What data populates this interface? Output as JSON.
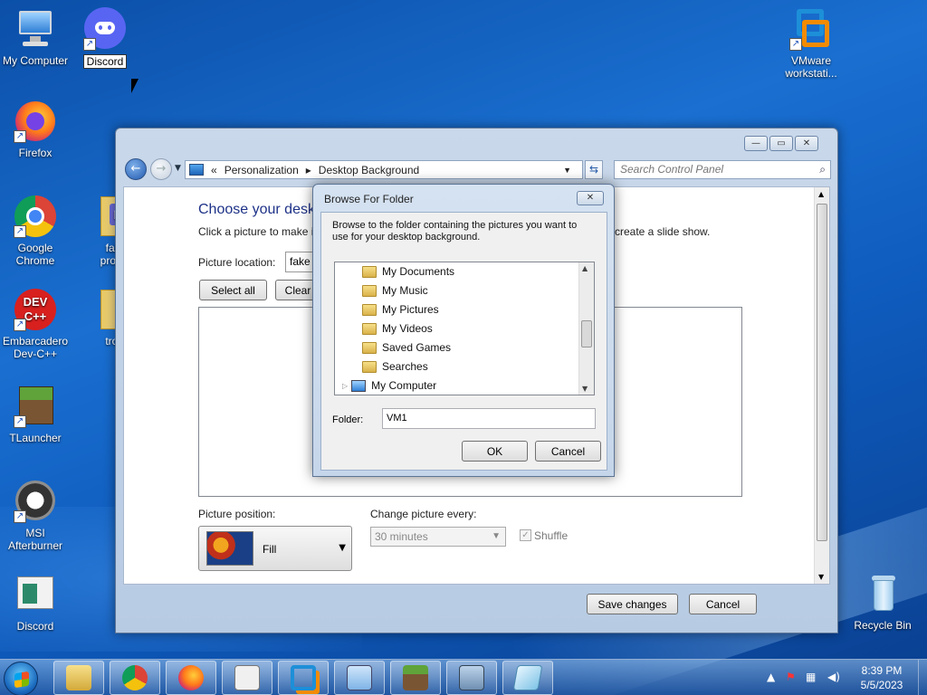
{
  "desktop": {
    "icons": [
      {
        "label": "My Computer"
      },
      {
        "label": "Discord"
      },
      {
        "label": "Firefox"
      },
      {
        "label": "Google Chrome"
      },
      {
        "label": "fake progra"
      },
      {
        "label": "Embarcadero Dev-C++"
      },
      {
        "label": "troja"
      },
      {
        "label": "TLauncher"
      },
      {
        "label": "MSI Afterburner"
      },
      {
        "label": "Discord"
      },
      {
        "label": "VMware workstati..."
      },
      {
        "label": "Recycle Bin"
      }
    ]
  },
  "window": {
    "breadcrumb": [
      "Personalization",
      "Desktop Background"
    ],
    "breadcrumb_prefix": "«",
    "search_placeholder": "Search Control Panel",
    "title": "Choose your deskt",
    "description_left": "Click a picture to make i",
    "description_right": "create a slide show.",
    "picture_location_label": "Picture location:",
    "picture_location_value": "fake p",
    "select_all": "Select all",
    "clear_all": "Clear",
    "picture_position_label": "Picture position:",
    "picture_position_value": "Fill",
    "change_every_label": "Change picture every:",
    "change_every_value": "30 minutes",
    "shuffle_label": "Shuffle",
    "save_changes": "Save changes",
    "cancel": "Cancel"
  },
  "dialog": {
    "title": "Browse For Folder",
    "instructions": "Browse to the folder containing the pictures you want to use for your desktop background.",
    "tree": [
      "My Documents",
      "My Music",
      "My Pictures",
      "My Videos",
      "Saved Games",
      "Searches",
      "My Computer"
    ],
    "folder_label": "Folder:",
    "folder_value": "VM1",
    "ok": "OK",
    "cancel": "Cancel"
  },
  "taskbar": {
    "time": "8:39 PM",
    "date": "5/5/2023"
  }
}
